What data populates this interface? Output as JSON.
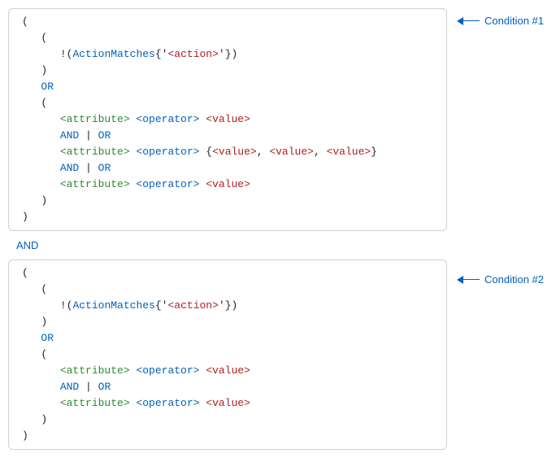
{
  "callouts": {
    "c1": "Condition #1",
    "c2": "Condition #2"
  },
  "joiner": "AND",
  "tokens": {
    "open_paren": "(",
    "close_paren": ")",
    "open_brace": "{",
    "close_brace": "}",
    "comma": ",",
    "quote": "'",
    "bang": "!",
    "pipe": "|",
    "OR": "OR",
    "AND": "AND",
    "action_fn": "ActionMatches",
    "action_ph": "<action>",
    "attr_ph": "<attribute>",
    "op_ph": "<operator>",
    "val_ph": "<value>"
  }
}
